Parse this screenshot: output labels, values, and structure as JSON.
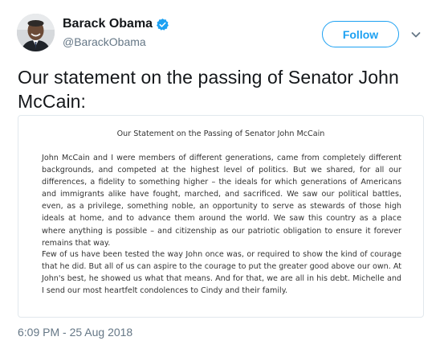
{
  "author": {
    "display_name": "Barack Obama",
    "handle": "@BarackObama",
    "avatar_icon": "avatar-photo",
    "verified_icon": "verified-badge-icon",
    "verified_color": "#1da1f2"
  },
  "actions": {
    "follow_label": "Follow",
    "menu_icon": "chevron-down-icon"
  },
  "tweet": {
    "text": "Our statement on the passing of Senator John McCain:",
    "timestamp": "6:09 PM - 25 Aug 2018"
  },
  "attached_image": {
    "title": "Our Statement on the Passing of Senator John McCain",
    "paragraphs": [
      "John McCain and I were members of different generations, came from completely different backgrounds, and competed at the highest level of politics. But we shared, for all our differences, a fidelity to something higher – the ideals for which generations of Americans and immigrants alike have fought, marched, and sacrificed. We saw our political battles, even, as a privilege, something noble, an opportunity to serve as stewards of those high ideals at home, and to advance them around the world. We saw this country as a place where anything is possible – and citizenship as our patriotic obligation to ensure it forever remains that way.",
      "Few of us have been tested the way John once was, or required to show the kind of courage that he did. But all of us can aspire to the courage to put the greater good above our own. At John's best, he showed us what that means. And for that, we are all in his debt. Michelle and I send our most heartfelt condolences to Cindy and their family."
    ]
  },
  "colors": {
    "accent": "#1da1f2",
    "text_primary": "#14171a",
    "text_secondary": "#657786",
    "border": "#e1e8ed"
  }
}
